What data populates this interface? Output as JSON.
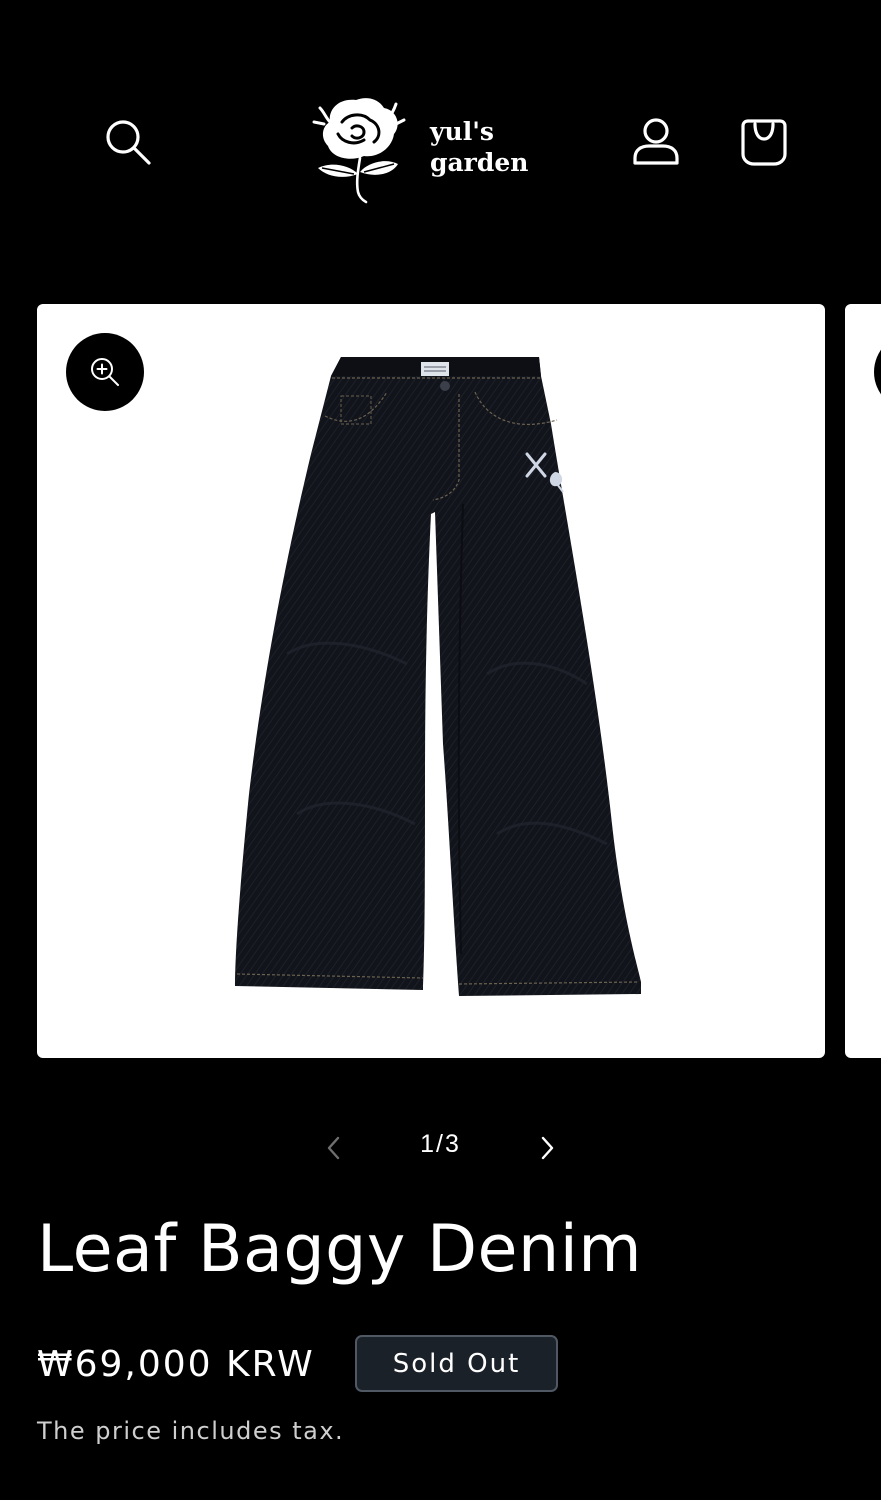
{
  "header": {
    "brand_line1": "yul's",
    "brand_line2": "garden",
    "icons": [
      "search-icon",
      "account-icon",
      "cart-icon"
    ]
  },
  "gallery": {
    "current_slide": 1,
    "total_slides": 3,
    "counter_separator": "/"
  },
  "product": {
    "title": "Leaf Baggy Denim",
    "price": "₩69,000 KRW",
    "badge": "Sold Out",
    "tax_note": "The price includes tax."
  },
  "colors": {
    "background": "#000000",
    "text": "#ffffff",
    "badge_background": "#1b2129",
    "badge_border": "#505863"
  }
}
